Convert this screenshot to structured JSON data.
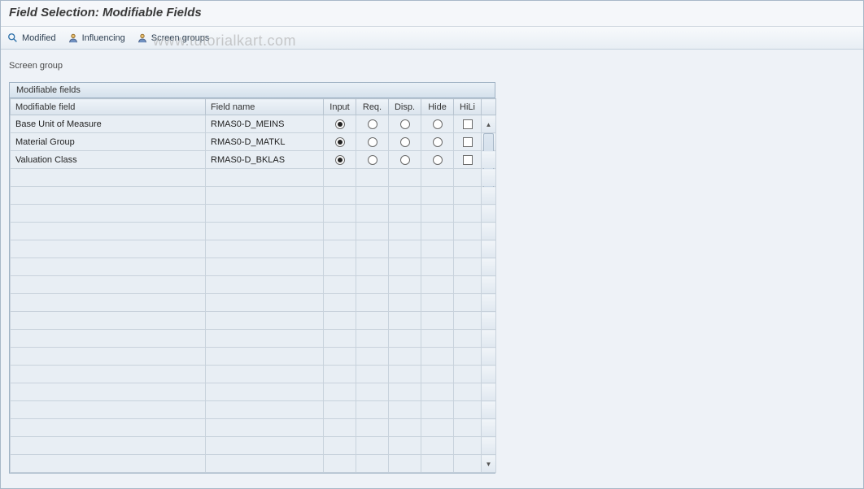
{
  "title": "Field Selection: Modifiable Fields",
  "toolbar": {
    "modified": "Modified",
    "influencing": "Influencing",
    "screen_groups": "Screen groups"
  },
  "watermark": "www.tutorialkart.com",
  "screen_group_label": "Screen group",
  "panel_title": "Modifiable fields",
  "columns": {
    "modifiable_field": "Modifiable field",
    "field_name": "Field name",
    "input": "Input",
    "req": "Req.",
    "disp": "Disp.",
    "hide": "Hide",
    "hili": "HiLi"
  },
  "rows": [
    {
      "label": "Base Unit of Measure",
      "field": "RMAS0-D_MEINS",
      "selected": "input",
      "hili": false
    },
    {
      "label": "Material Group",
      "field": "RMAS0-D_MATKL",
      "selected": "input",
      "hili": false
    },
    {
      "label": "Valuation Class",
      "field": "RMAS0-D_BKLAS",
      "selected": "input",
      "hili": false
    }
  ],
  "empty_rows": 17
}
